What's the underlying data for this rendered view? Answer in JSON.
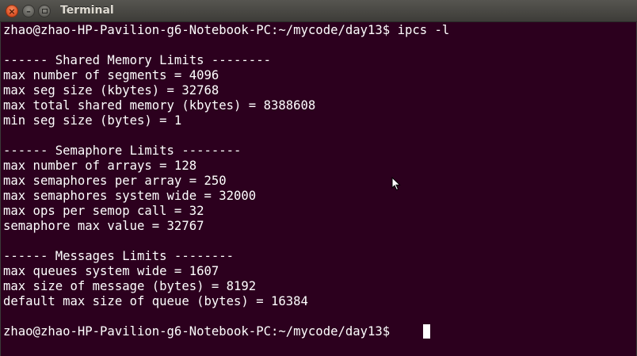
{
  "window": {
    "title": "Terminal",
    "close_glyph": "×",
    "minimize_glyph": "–"
  },
  "terminal": {
    "lines": [
      "zhao@zhao-HP-Pavilion-g6-Notebook-PC:~/mycode/day13$ ipcs -l",
      "",
      "------ Shared Memory Limits --------",
      "max number of segments = 4096",
      "max seg size (kbytes) = 32768",
      "max total shared memory (kbytes) = 8388608",
      "min seg size (bytes) = 1",
      "",
      "------ Semaphore Limits --------",
      "max number of arrays = 128",
      "max semaphores per array = 250",
      "max semaphores system wide = 32000",
      "max ops per semop call = 32",
      "semaphore max value = 32767",
      "",
      "------ Messages Limits --------",
      "max queues system wide = 1607",
      "max size of message (bytes) = 8192",
      "default max size of queue (bytes) = 16384",
      "",
      "zhao@zhao-HP-Pavilion-g6-Notebook-PC:~/mycode/day13$ "
    ]
  },
  "colors": {
    "background": "#2c001e",
    "foreground": "#ffffff",
    "titlebar": "#3d3c38",
    "close_button": "#e0562a"
  }
}
